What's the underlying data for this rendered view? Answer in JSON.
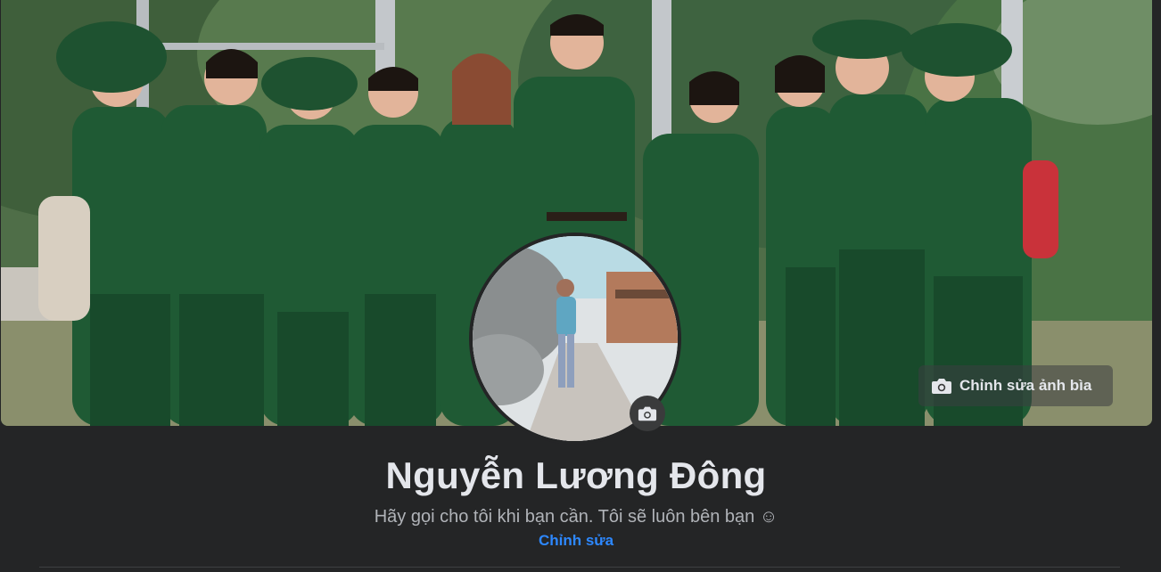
{
  "profile": {
    "name": "Nguyễn Lương Đông",
    "bio": "Hãy gọi cho tôi khi bạn cần. Tôi sẽ luôn bên bạn ☺",
    "edit_bio_label": "Chỉnh sửa"
  },
  "cover": {
    "edit_label": "Chỉnh sửa ảnh bìa",
    "edit_icon": "camera-icon"
  },
  "avatar": {
    "edit_icon": "camera-icon"
  },
  "colors": {
    "background": "#242526",
    "text_primary": "#e4e6eb",
    "text_secondary": "#b0b3b8",
    "link": "#2d88ff",
    "uniform_green": "#1f5a34"
  }
}
